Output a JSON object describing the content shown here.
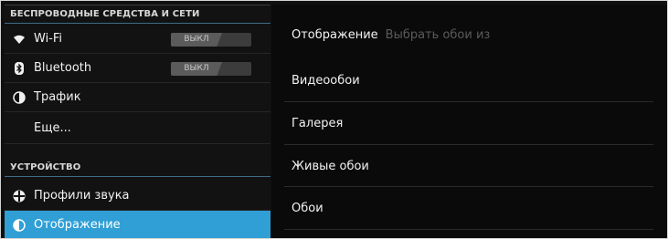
{
  "left_panel": {
    "wireless_header": "БЕСПРОВОДНЫЕ СРЕДСТВА И СЕТИ",
    "wifi": {
      "label": "Wi-Fi",
      "toggle": "ВЫКЛ",
      "icon": "wifi-icon"
    },
    "bluetooth": {
      "label": "Bluetooth",
      "toggle": "ВЫКЛ",
      "icon": "bluetooth-icon"
    },
    "traffic": {
      "label": "Трафик",
      "icon": "data-usage-icon"
    },
    "more": {
      "label": "Еще..."
    },
    "device_header": "УСТРОЙСТВО",
    "sound_profiles": {
      "label": "Профили звука",
      "icon": "sound-profiles-icon"
    },
    "display": {
      "label": "Отображение",
      "icon": "display-icon",
      "selected": true
    }
  },
  "right_panel": {
    "header": {
      "title": "Отображение",
      "subtitle": "Выбрать обои из"
    },
    "items": [
      {
        "label": "Видеообои"
      },
      {
        "label": "Галерея"
      },
      {
        "label": "Живые обои"
      },
      {
        "label": "Обои"
      }
    ]
  },
  "colors": {
    "accent": "#2f9fd6",
    "background": "#101010"
  }
}
